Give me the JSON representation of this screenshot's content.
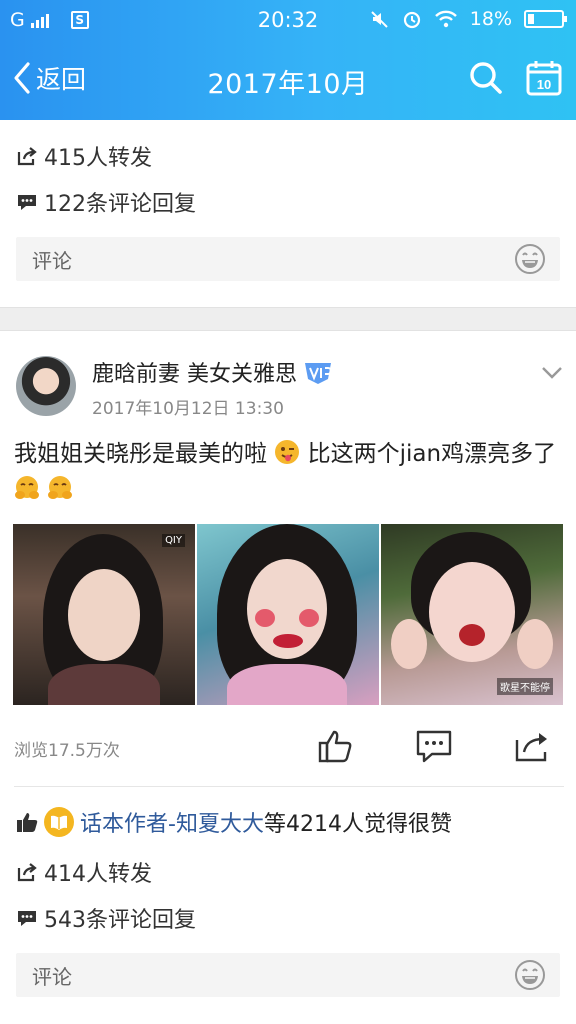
{
  "statusbar": {
    "carrier": "G",
    "sim_icon_text": "S",
    "time": "20:32",
    "battery": "18%",
    "battery_level": 0.18
  },
  "nav": {
    "back_label": "返回",
    "title": "2017年10月",
    "calendar_icon_text": "10"
  },
  "prev_post": {
    "reposts": "415人转发",
    "comments": "122条评论回复",
    "comment_placeholder": "评论"
  },
  "post": {
    "author": "鹿晗前妻 美女关雅思",
    "time": "2017年10月12日 13:30",
    "text_part1": "我姐姐关晓彤是最美的啦",
    "text_part2": " 比这两个jian鸡漂亮多了",
    "photo1_watermark": "QIY",
    "photo3_watermark": "歌星不能停",
    "views": "浏览17.5万次",
    "liker_name": "话本作者-知夏大大",
    "likes_suffix": "等4214人觉得很赞",
    "reposts": "414人转发",
    "comments": "543条评论回复",
    "comment_placeholder": "评论"
  },
  "icons": {
    "back": "chevron-left-icon",
    "search": "search-icon",
    "calendar": "calendar-icon",
    "repost": "share-arrow-icon",
    "comment": "speech-bubble-icon",
    "emoji": "grin-emoji-icon",
    "vip": "vip-badge-icon",
    "more": "chevron-down-icon",
    "like": "thumbs-up-icon",
    "share": "share-icon"
  },
  "colors": {
    "header_start": "#2a92f0",
    "header_end": "#2fc2f3",
    "link": "#2f5a9b",
    "meta": "#888888"
  }
}
